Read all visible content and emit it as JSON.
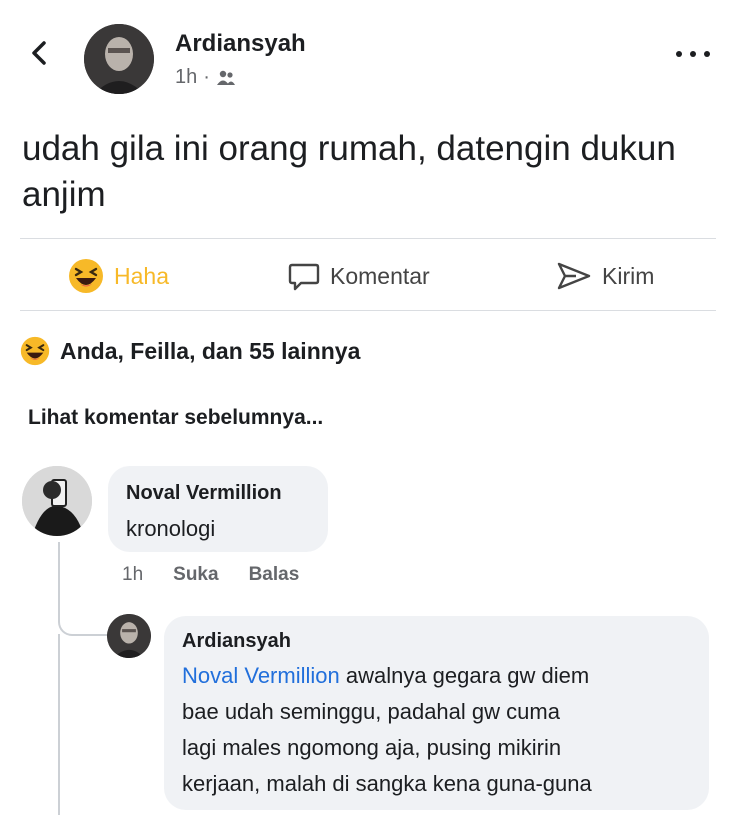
{
  "post": {
    "author": "Ardiansyah",
    "time": "1h",
    "separator": "·",
    "audience_icon": "friends-icon",
    "text": "udah gila ini orang rumah, datengin dukun anjim"
  },
  "actions": {
    "haha": "Haha",
    "comment": "Komentar",
    "send": "Kirim"
  },
  "reactions_summary": "Anda, Feilla, dan 55 lainnya",
  "view_previous": "Lihat komentar sebelumnya...",
  "comment": {
    "author": "Noval Vermillion",
    "text": "kronologi",
    "time": "1h",
    "like": "Suka",
    "reply": "Balas"
  },
  "reply": {
    "author": "Ardiansyah",
    "mention": "Noval Vermillion",
    "line1": " awalnya gegara gw diem",
    "line2": "bae udah seminggu, padahal gw cuma",
    "line3": "lagi males ngomong aja, pusing mikirin",
    "line4": "kerjaan, malah di sangka kena guna-guna"
  },
  "colors": {
    "haha": "#f7b928",
    "mention": "#216fdb",
    "muted": "#65676b",
    "bubble": "#f0f2f5"
  }
}
